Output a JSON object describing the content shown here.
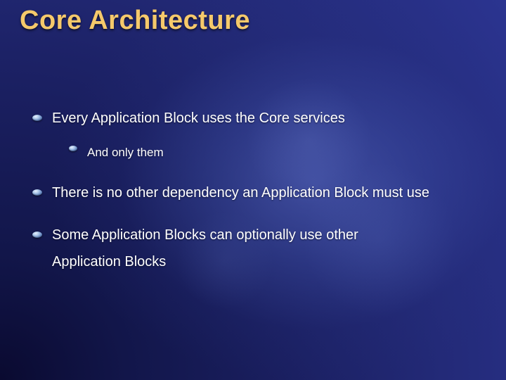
{
  "title": "Core Architecture",
  "bullets": [
    {
      "text": "Every Application Block uses the Core services",
      "sub": [
        {
          "text": "And only them"
        }
      ]
    },
    {
      "text": "There is no other dependency an Application Block must use"
    },
    {
      "text_line1": "Some Application Blocks can optionally use other",
      "text_line2": "Application Blocks"
    }
  ]
}
